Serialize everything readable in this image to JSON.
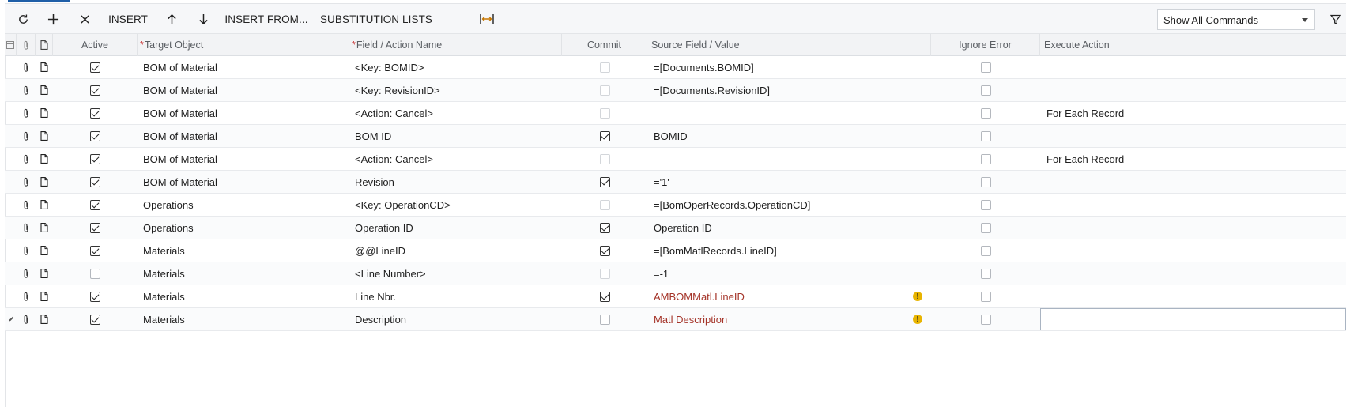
{
  "toolbar": {
    "refresh_icon": "refresh-icon",
    "add_icon": "plus-icon",
    "delete_icon": "close-icon",
    "insert_label": "INSERT",
    "move_up_icon": "arrow-up-icon",
    "move_down_icon": "arrow-down-icon",
    "insert_from_label": "INSERT FROM...",
    "substitution_label": "SUBSTITUTION LISTS",
    "fit_icon": "fit-columns-icon",
    "command_filter_value": "Show All Commands",
    "filter_icon": "filter-icon"
  },
  "grid": {
    "columns": {
      "active": "Active",
      "target_object": "Target Object",
      "field_action": "Field / Action Name",
      "commit": "Commit",
      "source": "Source Field / Value",
      "ignore_error": "Ignore Error",
      "execute_action": "Execute Action"
    },
    "rows": [
      {
        "active": true,
        "target": "BOM of Material",
        "field": "<Key: BOMID>",
        "commit": false,
        "commit_enabled": false,
        "source": "=[Documents.BOMID]",
        "warning": false,
        "ignore": false,
        "execute": ""
      },
      {
        "active": true,
        "target": "BOM of Material",
        "field": "<Key: RevisionID>",
        "commit": false,
        "commit_enabled": false,
        "source": "=[Documents.RevisionID]",
        "warning": false,
        "ignore": false,
        "execute": ""
      },
      {
        "active": true,
        "target": "BOM of Material",
        "field": "<Action: Cancel>",
        "commit": false,
        "commit_enabled": false,
        "source": "",
        "warning": false,
        "ignore": false,
        "execute": "For Each Record"
      },
      {
        "active": true,
        "target": "BOM of Material",
        "field": "BOM ID",
        "commit": true,
        "commit_enabled": true,
        "source": "BOMID",
        "warning": false,
        "ignore": false,
        "execute": ""
      },
      {
        "active": true,
        "target": "BOM of Material",
        "field": "<Action: Cancel>",
        "commit": false,
        "commit_enabled": false,
        "source": "",
        "warning": false,
        "ignore": false,
        "execute": "For Each Record"
      },
      {
        "active": true,
        "target": "BOM of Material",
        "field": "Revision",
        "commit": true,
        "commit_enabled": true,
        "source": "='1'",
        "warning": false,
        "ignore": false,
        "execute": ""
      },
      {
        "active": true,
        "target": "Operations",
        "field": "<Key: OperationCD>",
        "commit": false,
        "commit_enabled": false,
        "source": "=[BomOperRecords.OperationCD]",
        "warning": false,
        "ignore": false,
        "execute": ""
      },
      {
        "active": true,
        "target": "Operations",
        "field": "Operation ID",
        "commit": true,
        "commit_enabled": true,
        "source": "Operation ID",
        "warning": false,
        "ignore": false,
        "execute": ""
      },
      {
        "active": true,
        "target": "Materials",
        "field": "@@LineID",
        "commit": true,
        "commit_enabled": true,
        "source": "=[BomMatlRecords.LineID]",
        "warning": false,
        "ignore": false,
        "execute": ""
      },
      {
        "active": false,
        "target": "Materials",
        "field": "<Line Number>",
        "commit": false,
        "commit_enabled": false,
        "source": "=-1",
        "warning": false,
        "ignore": false,
        "execute": ""
      },
      {
        "active": true,
        "target": "Materials",
        "field": "Line Nbr.",
        "commit": true,
        "commit_enabled": true,
        "source": "AMBOMMatl.LineID",
        "warning": true,
        "ignore": false,
        "execute": ""
      },
      {
        "active": true,
        "target": "Materials",
        "field": "Description",
        "commit": false,
        "commit_enabled": true,
        "source": "Matl Description",
        "warning": true,
        "ignore": false,
        "execute": "",
        "selected": true
      }
    ]
  },
  "colors": {
    "accent": "#1f5fa8",
    "error_text": "#a5352a",
    "warning": "#e8b400"
  }
}
